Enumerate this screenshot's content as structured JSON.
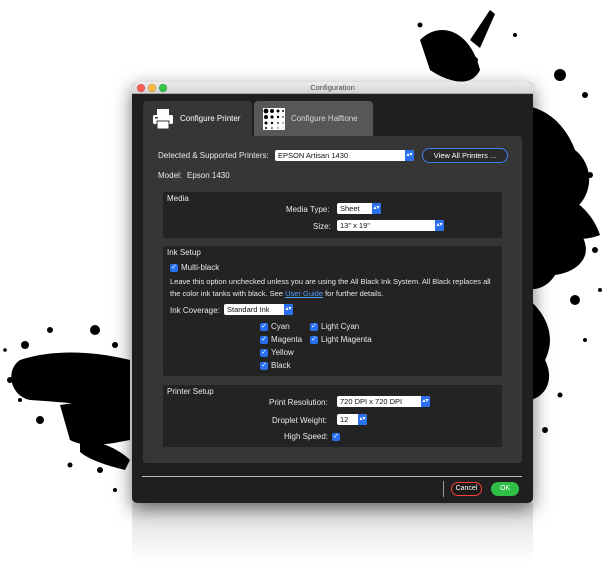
{
  "window": {
    "title": "Configuration"
  },
  "tabs": [
    {
      "label": "Configure Printer",
      "icon": "printer-icon",
      "active": true
    },
    {
      "label": "Configure Halftone",
      "icon": "halftone-icon",
      "active": false
    }
  ],
  "printer": {
    "detected_label": "Detected & Supported Printers:",
    "selected": "EPSON Artisan 1430",
    "view_all_label": "View All Printers ...",
    "model_label": "Model:",
    "model_value": "Epson 1430"
  },
  "media": {
    "title": "Media",
    "type_label": "Media Type:",
    "type_value": "Sheet",
    "size_label": "Size:",
    "size_value": "13\" x 19\""
  },
  "ink": {
    "title": "Ink Setup",
    "multiblack_label": "Multi-black",
    "description_before": "Leave this option unchecked unless you are using the All Black Ink System. All Black replaces all the color ink tanks with black. See ",
    "description_link": "User Guide",
    "description_after": " for further details.",
    "coverage_label": "Ink Coverage:",
    "coverage_value": "Standard Ink",
    "colors": [
      "Cyan",
      "Light Cyan",
      "Magenta",
      "Light Magenta",
      "Yellow",
      "Black"
    ]
  },
  "setup": {
    "title": "Printer Setup",
    "resolution_label": "Print Resolution:",
    "resolution_value": "720 DPI x 720 DPI",
    "droplet_label": "Droplet Weight:",
    "droplet_value": "12",
    "highspeed_label": "High Speed:"
  },
  "footer": {
    "cancel_label": "Cancel",
    "ok_label": "OK"
  },
  "colors": {
    "accent": "#2a6ff0",
    "ok": "#2fbf47",
    "cancel_border": "#ff3b3b",
    "link": "#4e9dff"
  }
}
